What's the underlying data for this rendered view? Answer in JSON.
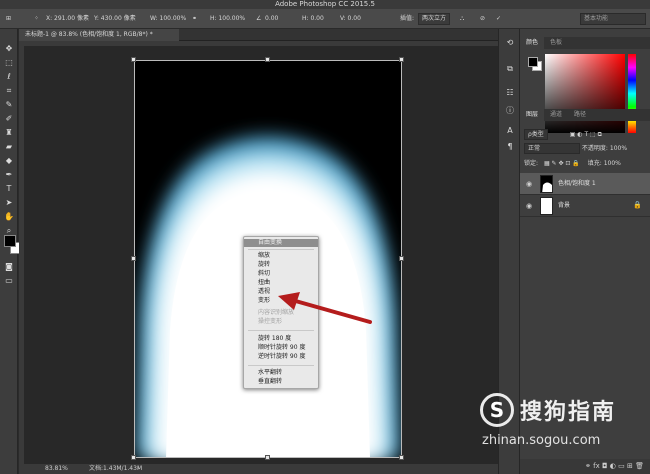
{
  "app": {
    "title": "Adobe Photoshop CC 2015.5"
  },
  "options_bar": {
    "x": "X: 291.00 像素",
    "y": "Y: 430.00 像素",
    "w": "W: 100.00%",
    "h": "H: 100.00%",
    "angle": "0.00",
    "skew_h": "H: 0.00",
    "skew_v": "V: 0.00",
    "interp_label": "插值:",
    "interp_value": "两次立方",
    "search_placeholder": "基本功能"
  },
  "document": {
    "tab_label": "未标题-1 @ 83.8% (色相/饱和度 1, RGB/8*) *"
  },
  "status": {
    "zoom": "83.81%",
    "doc_size": "文档:1.43M/1.43M"
  },
  "context_menu": {
    "header": "自由变换",
    "group1": [
      "缩放",
      "旋转",
      "斜切",
      "扭曲",
      "透视",
      "变形"
    ],
    "disabled": [
      "内容识别缩放",
      "操控变形"
    ],
    "group2": [
      "旋转 180 度",
      "顺时针旋转 90 度",
      "逆时针旋转 90 度"
    ],
    "group3": [
      "水平翻转",
      "垂直翻转"
    ]
  },
  "color_panel": {
    "tabs": [
      "颜色",
      "色板"
    ]
  },
  "layers_panel": {
    "tabs": [
      "图层",
      "通道",
      "路径"
    ],
    "kind_label": "ρ类型",
    "blend_mode": "正常",
    "opacity_label": "不透明度:",
    "opacity_value": "100%",
    "lock_label": "锁定:",
    "fill_label": "填充:",
    "fill_value": "100%",
    "layers": [
      {
        "name": "色相/饱和度 1",
        "selected": true
      },
      {
        "name": "背景",
        "selected": false
      }
    ]
  },
  "watermark": {
    "brand": "搜狗指南",
    "url": "zhinan.sogou.com"
  }
}
